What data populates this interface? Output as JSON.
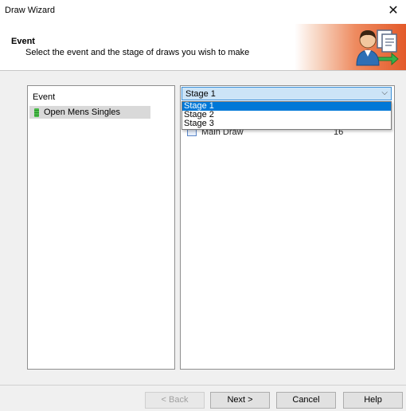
{
  "window": {
    "title": "Draw Wizard",
    "close_glyph": "✕"
  },
  "header": {
    "title": "Event",
    "subtitle": "Select the event and the stage of draws you wish to make",
    "icon": "wizard-person-icon"
  },
  "events_panel": {
    "header": "Event",
    "items": [
      {
        "label": "Open Mens Singles",
        "icon": "event-icon",
        "selected": true
      }
    ]
  },
  "stage_panel": {
    "selected": "Stage 1",
    "options": [
      "Stage 1",
      "Stage 2",
      "Stage 3"
    ],
    "dropdown_open": true,
    "draws": [
      {
        "name": "Main Draw",
        "size": "16"
      }
    ]
  },
  "footer": {
    "back": "< Back",
    "next": "Next >",
    "cancel": "Cancel",
    "help": "Help"
  },
  "colors": {
    "banner_accent": "#e35a2a",
    "selection": "#0078d7",
    "combo_highlight": "#cce4f7"
  }
}
